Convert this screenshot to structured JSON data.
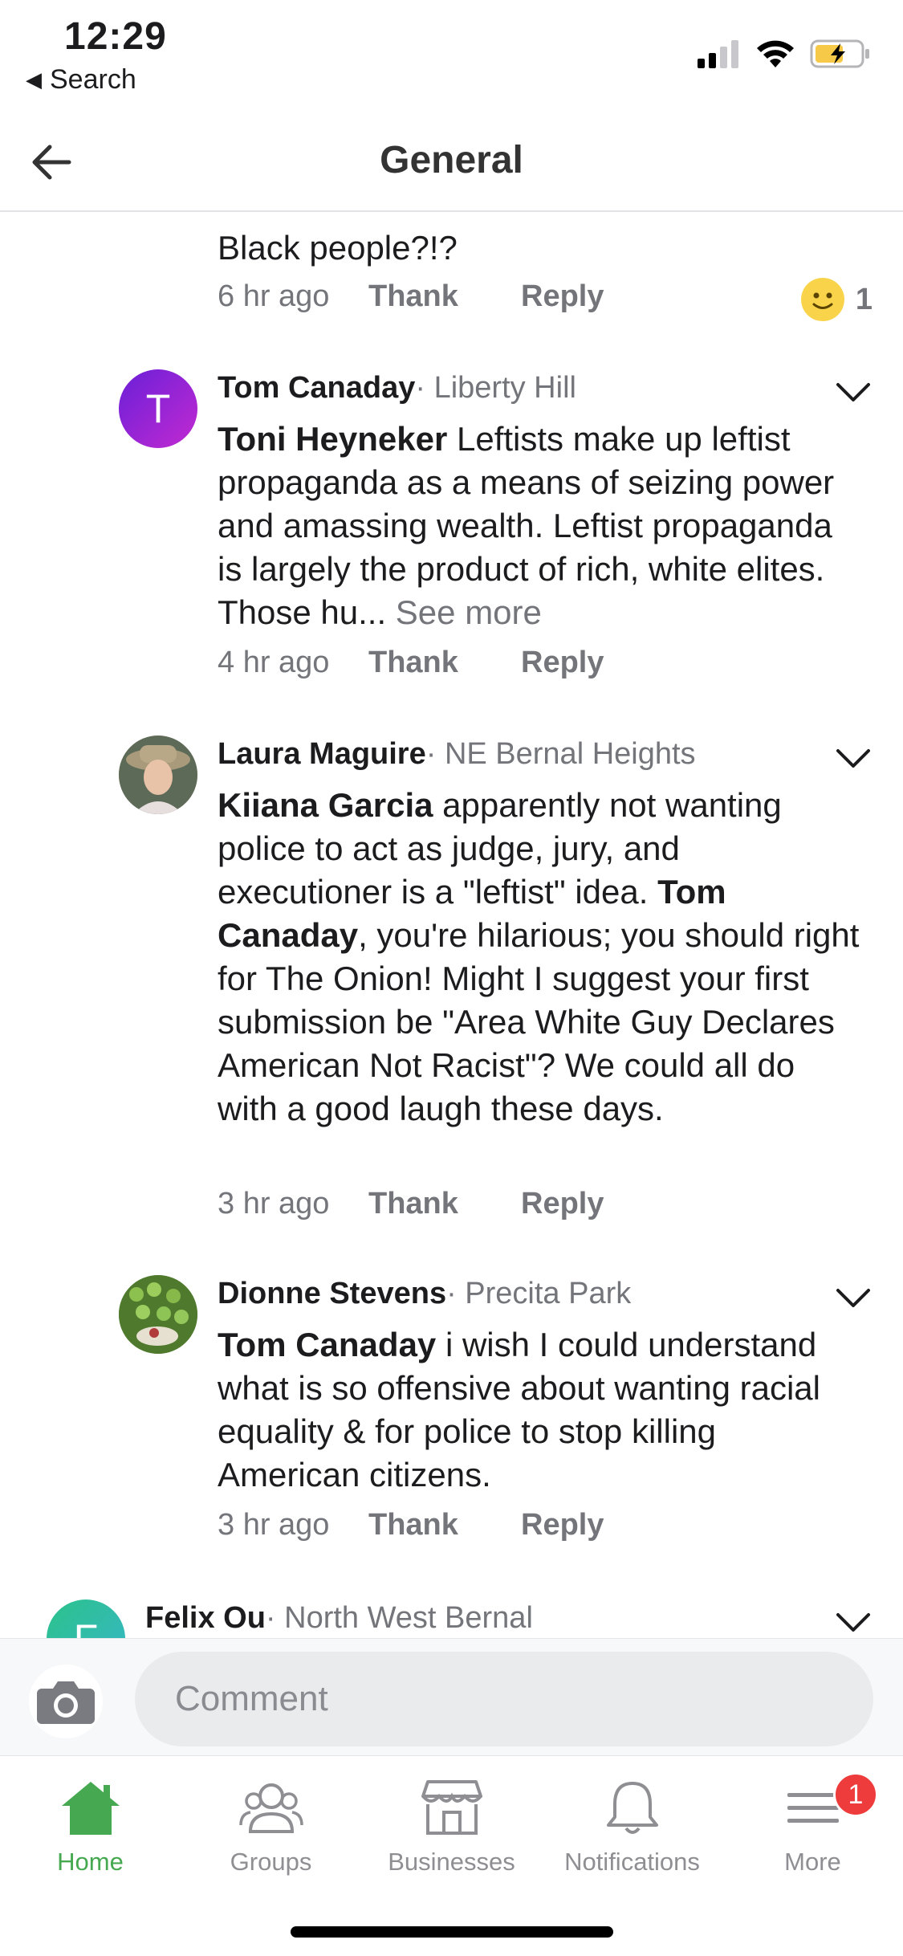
{
  "status_bar": {
    "time": "12:29",
    "back_app": "Search"
  },
  "header": {
    "title": "General"
  },
  "previous_comment": {
    "tail_text": "Black people?!?",
    "time": "6 hr ago",
    "thank": "Thank",
    "reply": "Reply",
    "reaction_count": "1"
  },
  "comments": [
    {
      "name": "Tom Canaday",
      "neighborhood": "· Liberty Hill",
      "avatar_letter": "T",
      "mention": "Toni Heyneker",
      "text": " Leftists make up leftist propaganda as a means of seizing power and amassing wealth. Leftist propaganda is largely the product of rich, white elites. Those hu... ",
      "see_more": "See more",
      "time": "4 hr ago",
      "thank": "Thank",
      "reply": "Reply"
    },
    {
      "name": "Laura Maguire",
      "neighborhood": "· NE Bernal Heights",
      "mention": "Kiiana Garcia",
      "text_part1": " apparently not wanting police to act as judge, jury, and executioner is a \"leftist\" idea. ",
      "mention2": "Tom Canaday",
      "text_part2": ", you're hilarious; you should right for The Onion! Might I suggest your first submission be \"Area White Guy Declares American Not Racist\"? We could all do with a good laugh these days.",
      "time": "3 hr ago",
      "thank": "Thank",
      "reply": "Reply"
    },
    {
      "name": "Dionne Stevens",
      "neighborhood": "· Precita Park",
      "mention": "Tom Canaday",
      "text": " i wish I could understand what is so offensive about wanting racial equality & for police to stop killing American citizens.",
      "time": "3 hr ago",
      "thank": "Thank",
      "reply": "Reply"
    },
    {
      "name": "Felix Ou",
      "neighborhood": "· North West Bernal",
      "avatar_letter": "F"
    }
  ],
  "comment_bar": {
    "placeholder": "Comment"
  },
  "tabs": [
    {
      "label": "Home",
      "active": true
    },
    {
      "label": "Groups"
    },
    {
      "label": "Businesses"
    },
    {
      "label": "Notifications"
    },
    {
      "label": "More",
      "badge": "1"
    }
  ],
  "colors": {
    "accent_green": "#46a951",
    "badge_red": "#ee3b3b",
    "avatar_purple": "#8e2de2"
  }
}
